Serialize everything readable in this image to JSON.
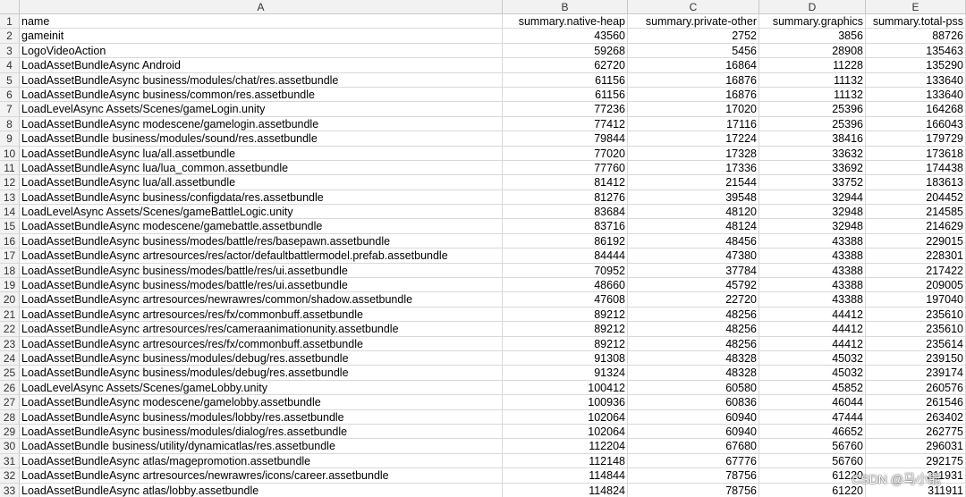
{
  "columns": [
    "A",
    "B",
    "C",
    "D",
    "E"
  ],
  "rows": [
    {
      "n": "1",
      "a": "name",
      "b": "summary.native-heap",
      "c": "summary.private-other",
      "d": "summary.graphics",
      "e": "summary.total-pss"
    },
    {
      "n": "2",
      "a": "gameinit",
      "b": "43560",
      "c": "2752",
      "d": "3856",
      "e": "88726"
    },
    {
      "n": "3",
      "a": "LogoVideoAction",
      "b": "59268",
      "c": "5456",
      "d": "28908",
      "e": "135463"
    },
    {
      "n": "4",
      "a": "LoadAssetBundleAsync  Android",
      "b": "62720",
      "c": "16864",
      "d": "11228",
      "e": "135290"
    },
    {
      "n": "5",
      "a": "LoadAssetBundleAsync  business/modules/chat/res.assetbundle",
      "b": "61156",
      "c": "16876",
      "d": "11132",
      "e": "133640"
    },
    {
      "n": "6",
      "a": "LoadAssetBundleAsync  business/common/res.assetbundle",
      "b": "61156",
      "c": "16876",
      "d": "11132",
      "e": "133640"
    },
    {
      "n": "7",
      "a": "LoadLevelAsync  Assets/Scenes/gameLogin.unity",
      "b": "77236",
      "c": "17020",
      "d": "25396",
      "e": "164268"
    },
    {
      "n": "8",
      "a": "LoadAssetBundleAsync  modescene/gamelogin.assetbundle",
      "b": "77412",
      "c": "17116",
      "d": "25396",
      "e": "166043"
    },
    {
      "n": "9",
      "a": "LoadAssetBundle  business/modules/sound/res.assetbundle",
      "b": "79844",
      "c": "17224",
      "d": "38416",
      "e": "179729"
    },
    {
      "n": "10",
      "a": "LoadAssetBundleAsync  lua/all.assetbundle",
      "b": "77020",
      "c": "17328",
      "d": "33632",
      "e": "173618"
    },
    {
      "n": "11",
      "a": "LoadAssetBundleAsync  lua/lua_common.assetbundle",
      "b": "77760",
      "c": "17336",
      "d": "33692",
      "e": "174438"
    },
    {
      "n": "12",
      "a": "LoadAssetBundleAsync  lua/all.assetbundle",
      "b": "81412",
      "c": "21544",
      "d": "33752",
      "e": "183613"
    },
    {
      "n": "13",
      "a": "LoadAssetBundleAsync  business/configdata/res.assetbundle",
      "b": "81276",
      "c": "39548",
      "d": "32944",
      "e": "204452"
    },
    {
      "n": "14",
      "a": "LoadLevelAsync  Assets/Scenes/gameBattleLogic.unity",
      "b": "83684",
      "c": "48120",
      "d": "32948",
      "e": "214585"
    },
    {
      "n": "15",
      "a": "LoadAssetBundleAsync  modescene/gamebattle.assetbundle",
      "b": "83716",
      "c": "48124",
      "d": "32948",
      "e": "214629"
    },
    {
      "n": "16",
      "a": "LoadAssetBundleAsync  business/modes/battle/res/basepawn.assetbundle",
      "b": "86192",
      "c": "48456",
      "d": "43388",
      "e": "229015"
    },
    {
      "n": "17",
      "a": "LoadAssetBundleAsync  artresources/res/actor/defaultbattlermodel.prefab.assetbundle",
      "b": "84444",
      "c": "47380",
      "d": "43388",
      "e": "228301"
    },
    {
      "n": "18",
      "a": "LoadAssetBundleAsync  business/modes/battle/res/ui.assetbundle",
      "b": "70952",
      "c": "37784",
      "d": "43388",
      "e": "217422"
    },
    {
      "n": "19",
      "a": "LoadAssetBundleAsync  business/modes/battle/res/ui.assetbundle",
      "b": "48660",
      "c": "45792",
      "d": "43388",
      "e": "209005"
    },
    {
      "n": "20",
      "a": "LoadAssetBundleAsync  artresources/newrawres/common/shadow.assetbundle",
      "b": "47608",
      "c": "22720",
      "d": "43388",
      "e": "197040"
    },
    {
      "n": "21",
      "a": "LoadAssetBundleAsync  artresources/res/fx/commonbuff.assetbundle",
      "b": "89212",
      "c": "48256",
      "d": "44412",
      "e": "235610"
    },
    {
      "n": "22",
      "a": "LoadAssetBundleAsync  artresources/res/cameraanimationunity.assetbundle",
      "b": "89212",
      "c": "48256",
      "d": "44412",
      "e": "235610"
    },
    {
      "n": "23",
      "a": "LoadAssetBundleAsync  artresources/res/fx/commonbuff.assetbundle",
      "b": "89212",
      "c": "48256",
      "d": "44412",
      "e": "235614"
    },
    {
      "n": "24",
      "a": "LoadAssetBundleAsync  business/modules/debug/res.assetbundle",
      "b": "91308",
      "c": "48328",
      "d": "45032",
      "e": "239150"
    },
    {
      "n": "25",
      "a": "LoadAssetBundleAsync  business/modules/debug/res.assetbundle",
      "b": "91324",
      "c": "48328",
      "d": "45032",
      "e": "239174"
    },
    {
      "n": "26",
      "a": "LoadLevelAsync  Assets/Scenes/gameLobby.unity",
      "b": "100412",
      "c": "60580",
      "d": "45852",
      "e": "260576"
    },
    {
      "n": "27",
      "a": "LoadAssetBundleAsync  modescene/gamelobby.assetbundle",
      "b": "100936",
      "c": "60836",
      "d": "46044",
      "e": "261546"
    },
    {
      "n": "28",
      "a": "LoadAssetBundleAsync  business/modules/lobby/res.assetbundle",
      "b": "102064",
      "c": "60940",
      "d": "47444",
      "e": "263402"
    },
    {
      "n": "29",
      "a": "LoadAssetBundleAsync  business/modules/dialog/res.assetbundle",
      "b": "102064",
      "c": "60940",
      "d": "46652",
      "e": "262775"
    },
    {
      "n": "30",
      "a": "LoadAssetBundle  business/utility/dynamicatlas/res.assetbundle",
      "b": "112204",
      "c": "67680",
      "d": "56760",
      "e": "296031"
    },
    {
      "n": "31",
      "a": "LoadAssetBundleAsync  atlas/magepromotion.assetbundle",
      "b": "112148",
      "c": "67776",
      "d": "56760",
      "e": "292175"
    },
    {
      "n": "32",
      "a": "LoadAssetBundleAsync  artresources/newrawres/icons/career.assetbundle",
      "b": "114844",
      "c": "78756",
      "d": "61220",
      "e": "311931"
    },
    {
      "n": "33",
      "a": "LoadAssetBundleAsync  atlas/lobby.assetbundle",
      "b": "114824",
      "c": "78756",
      "d": "61220",
      "e": "311911"
    }
  ],
  "watermark": "CSDN @马小能"
}
